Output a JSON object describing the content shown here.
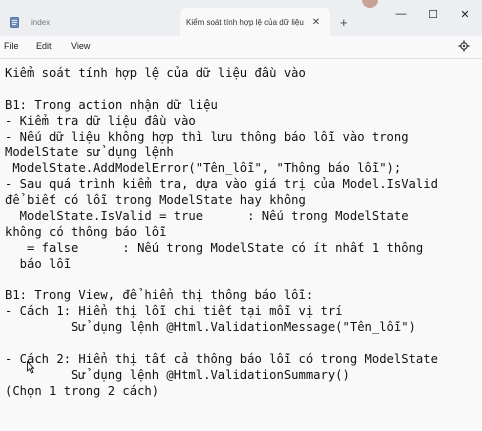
{
  "tabs": [
    {
      "label": "index",
      "active": false
    },
    {
      "label": "Kiểm soát tính hợp lệ của dữ liệu",
      "active": true
    }
  ],
  "new_tab_label": "+",
  "window_controls": {
    "minimize": "—",
    "maximize": "☐",
    "close": "✕"
  },
  "menu": {
    "file": "File",
    "edit": "Edit",
    "view": "View"
  },
  "icons": {
    "settings": "gear-icon",
    "document": "document-icon",
    "cursor": "mouse-pointer-icon"
  },
  "document": {
    "lines": [
      "Kiểm soát tính hợp lệ của dữ liệu đầu vào",
      "",
      "B1: Trong action nhận dữ liệu",
      "- Kiểm tra dữ liệu đầu vào",
      "- Nếu dữ liệu không hợp thì lưu thông báo lỗi vào trong",
      "ModelState sử dụng lệnh",
      " ModelState.AddModelError(\"Tên_lỗi\", \"Thông báo lỗi\");",
      "- Sau quá trình kiểm tra, dựa vào giá trị của Model.IsValid",
      "để biết có lỗi trong ModelState hay không",
      "  ModelState.IsValid = true      : Nếu trong ModelState",
      "không có thông báo lỗi",
      "   = false      : Nếu trong ModelState có ít nhất 1 thông",
      "  báo lỗi",
      "",
      "B1: Trong View, để hiển thị thông báo lỗi:",
      "- Cách 1: Hiển thị lỗi chi tiết tại mỗi vị trí",
      "         Sử dụng lệnh @Html.ValidationMessage(\"Tên_lỗi\")",
      "",
      "- Cách 2: Hiển thị tất cả thông báo lỗi có trong ModelState",
      "         Sử dụng lệnh @Html.ValidationSummary()",
      "(Chọn 1 trong 2 cách)"
    ]
  }
}
